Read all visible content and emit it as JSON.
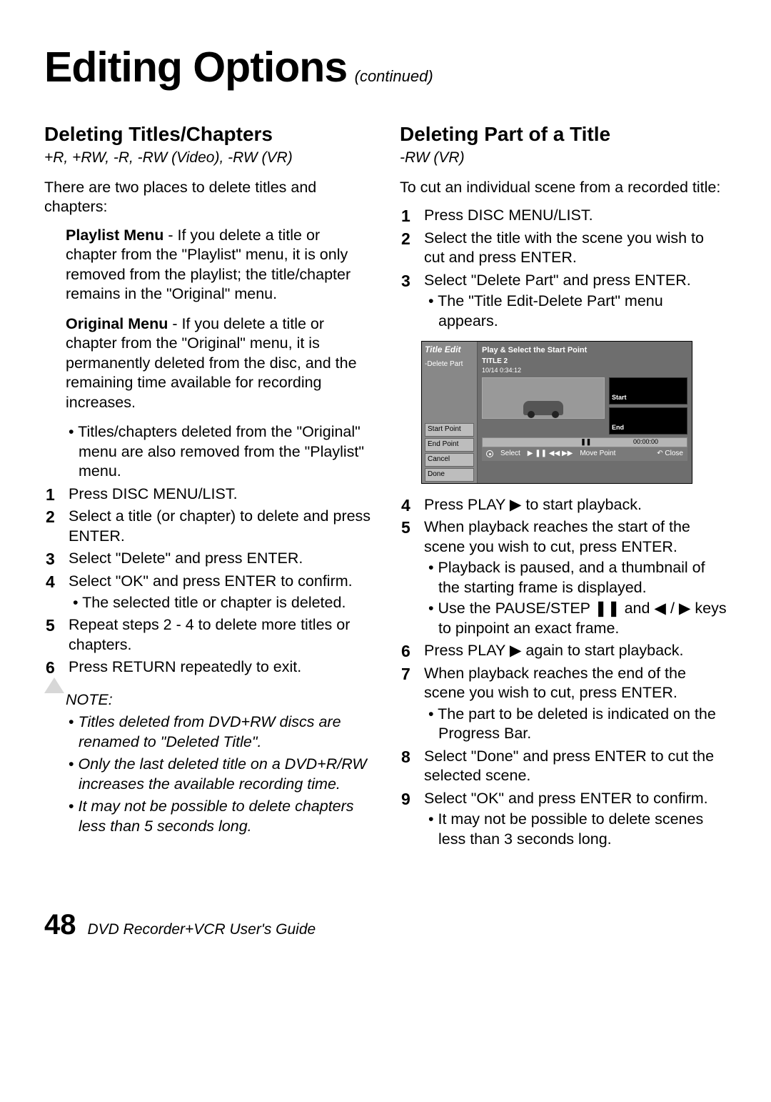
{
  "header": {
    "title": "Editing Options",
    "continued": "(continued)"
  },
  "left": {
    "heading": "Deleting Titles/Chapters",
    "formats": "+R, +RW, -R, -RW (Video), -RW (VR)",
    "intro": "There are two places to delete titles and chapters:",
    "playlist": {
      "lead": "Playlist Menu",
      "text": " - If you delete a title or chapter from the \"Playlist\" menu, it is only removed from the playlist; the title/chapter remains in the \"Original\" menu."
    },
    "original": {
      "lead": "Original Menu",
      "text": " - If you delete a title or chapter from the \"Original\" menu, it is permanently deleted from the disc, and the remaining time available for recording increases.",
      "sub": "Titles/chapters deleted from the \"Original\" menu are also removed from the \"Playlist\" menu."
    },
    "steps": [
      {
        "n": "1",
        "t": "Press DISC MENU/LIST."
      },
      {
        "n": "2",
        "t": "Select a title (or chapter) to delete and press ENTER."
      },
      {
        "n": "3",
        "t": "Select \"Delete\" and press ENTER."
      },
      {
        "n": "4",
        "t": "Select \"OK\" and press ENTER to confirm.",
        "sub": [
          "The selected title or chapter is deleted."
        ]
      },
      {
        "n": "5",
        "t": "Repeat steps 2 - 4 to delete more titles or chapters."
      },
      {
        "n": "6",
        "t": "Press RETURN repeatedly to exit."
      }
    ],
    "note": {
      "label": "NOTE:",
      "items": [
        "Titles deleted from DVD+RW discs are renamed to \"Deleted Title\".",
        "Only the last deleted title on a DVD+R/RW increases the available recording time.",
        "It may not be possible to delete chapters less than 5 seconds long."
      ]
    }
  },
  "right": {
    "heading": "Deleting Part of a Title",
    "formats": "-RW (VR)",
    "intro": "To cut an individual scene from a recorded title:",
    "steps_a": [
      {
        "n": "1",
        "t": "Press DISC MENU/LIST."
      },
      {
        "n": "2",
        "t": "Select the title with the scene you wish to cut and press ENTER."
      },
      {
        "n": "3",
        "t": "Select \"Delete Part\" and press ENTER.",
        "sub": [
          "The \"Title Edit-Delete Part\" menu appears."
        ]
      }
    ],
    "screenshot": {
      "side_title": "Title Edit",
      "side_sub": "-Delete Part",
      "side_buttons": [
        "Start Point",
        "End Point",
        "Cancel",
        "Done"
      ],
      "main_title": "Play & Select the Start Point",
      "title2": "TITLE 2",
      "meta": "10/14        0:34:12",
      "thumb_start": "Start",
      "thumb_end": "End",
      "bar_time": "00:00:00",
      "footer_select": "Select",
      "footer_controls": "▶  ❚❚  ◀◀  ▶▶",
      "footer_move": "Move Point",
      "footer_close": "Close"
    },
    "steps_b": [
      {
        "n": "4",
        "t": "Press PLAY ▶ to start playback."
      },
      {
        "n": "5",
        "t": "When playback reaches the start of the scene you wish to cut, press ENTER.",
        "sub": [
          "Playback is paused, and a thumbnail of the starting frame is displayed.",
          "Use the PAUSE/STEP ❚❚ and ◀ / ▶ keys to pinpoint an exact frame."
        ]
      },
      {
        "n": "6",
        "t": "Press PLAY ▶ again to start playback."
      },
      {
        "n": "7",
        "t": "When playback reaches the end of the scene you wish to cut, press ENTER.",
        "sub": [
          "The part to be deleted is indicated on the Progress Bar."
        ]
      },
      {
        "n": "8",
        "t": "Select \"Done\" and press ENTER to cut the selected scene."
      },
      {
        "n": "9",
        "t": "Select \"OK\" and press ENTER to confirm.",
        "sub": [
          "It may not be possible to delete scenes less than 3 seconds long."
        ]
      }
    ]
  },
  "footer": {
    "page": "48",
    "guide": "DVD Recorder+VCR User's Guide"
  }
}
